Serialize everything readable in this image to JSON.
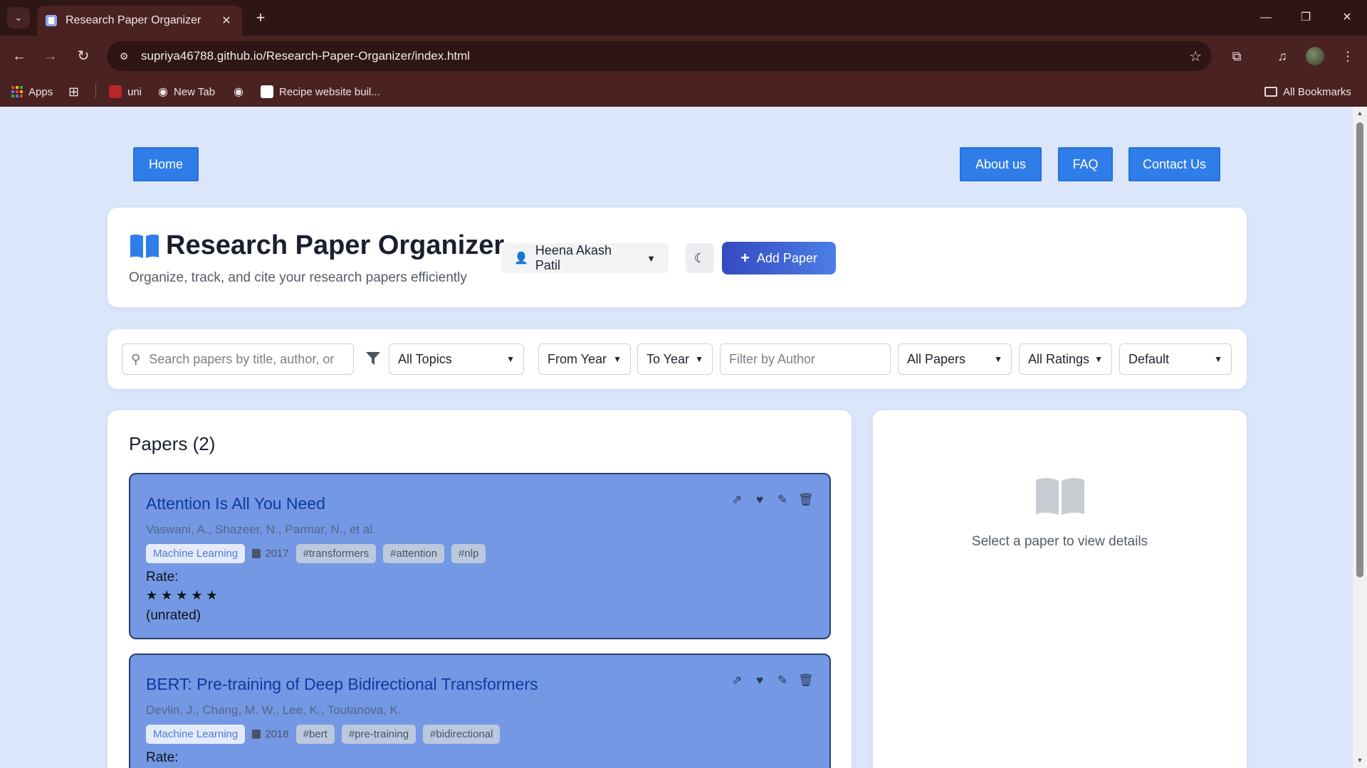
{
  "browser": {
    "tab_title": "Research Paper Organizer",
    "url": "supriya46788.github.io/Research-Paper-Organizer/index.html",
    "bookmarks": [
      {
        "label": "Apps"
      },
      {
        "label": "uni"
      },
      {
        "label": "New Tab"
      },
      {
        "label": "Recipe website buil..."
      }
    ],
    "all_bookmarks_label": "All Bookmarks"
  },
  "nav": {
    "home": "Home",
    "about": "About us",
    "faq": "FAQ",
    "contact": "Contact Us"
  },
  "header": {
    "title": "Research Paper Organizer",
    "subtitle": "Organize, track, and cite your research papers efficiently",
    "user_name": "Heena Akash Patil",
    "add_paper_label": "Add Paper"
  },
  "filters": {
    "search_placeholder": "Search papers by title, author, or abstract...",
    "topic": "All Topics",
    "from_year": "From Year",
    "to_year": "To Year",
    "author_placeholder": "Filter by Author",
    "papers": "All Papers",
    "ratings": "All Ratings",
    "sort": "Default"
  },
  "papers": {
    "heading": "Papers (2)",
    "items": [
      {
        "title": "Attention Is All You Need",
        "authors": "Vaswani, A., Shazeer, N., Parmar, N., et al.",
        "topic": "Machine Learning",
        "year": "2017",
        "tags": [
          "#transformers",
          "#attention",
          "#nlp"
        ],
        "rate_label": "Rate:",
        "stars": "★ ★ ★ ★ ★",
        "rating_text": "(unrated)"
      },
      {
        "title": "BERT: Pre-training of Deep Bidirectional Transformers",
        "authors": "Devlin, J., Chang, M. W., Lee, K., Toutanova, K.",
        "topic": "Machine Learning",
        "year": "2018",
        "tags": [
          "#bert",
          "#pre-training",
          "#bidirectional"
        ],
        "rate_label": "Rate:"
      }
    ]
  },
  "detail": {
    "placeholder": "Select a paper to view details"
  },
  "colors": {
    "page_bg": "#dbe6fb",
    "nav_button": "#2f7de8",
    "paper_card": "#7498e3",
    "paper_title": "#0e3aa0",
    "add_button_start": "#3549c0",
    "add_button_end": "#4c7ee6",
    "browser_frame": "#4a2222"
  }
}
